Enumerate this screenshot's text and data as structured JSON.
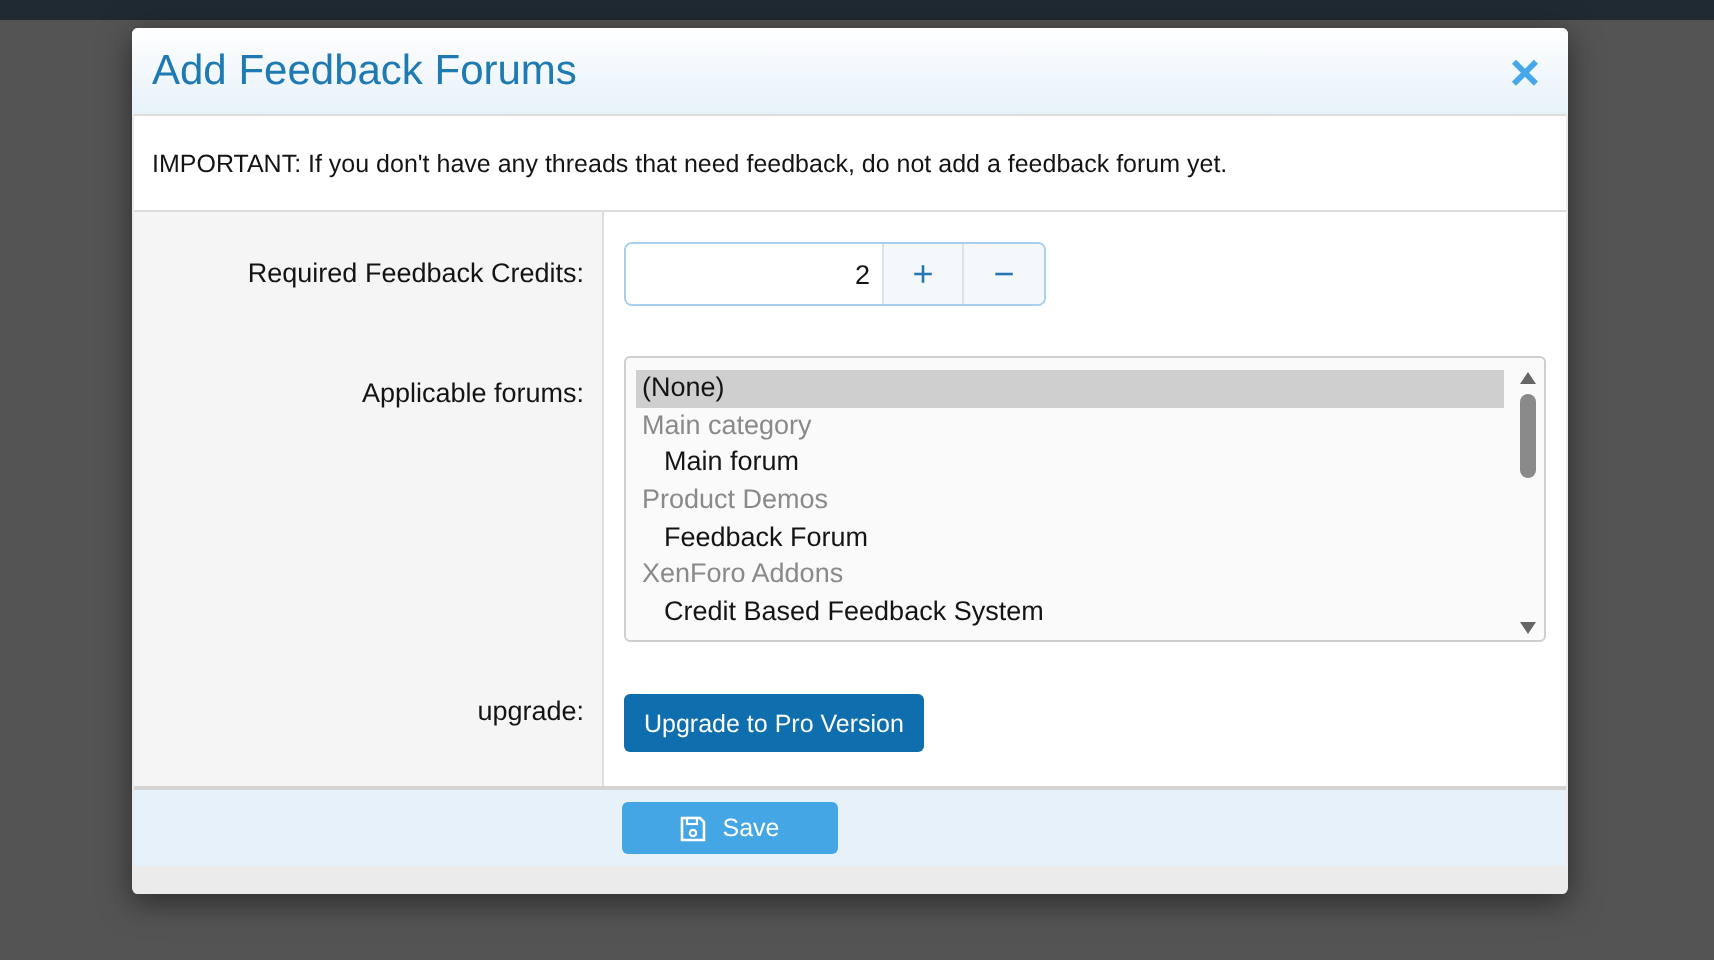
{
  "dialog": {
    "title": "Add Feedback Forums",
    "close": "×"
  },
  "notice": "IMPORTANT: If you don't have any threads that need feedback, do not add a feedback forum yet.",
  "form": {
    "credits": {
      "label": "Required Feedback Credits:",
      "value": "2",
      "plus": "+",
      "minus": "−"
    },
    "forums": {
      "label": "Applicable forums:",
      "options": [
        {
          "label": "(None)",
          "selected": true,
          "disabled": false
        },
        {
          "label": "Main category",
          "selected": false,
          "disabled": true,
          "children": [
            {
              "label": "Main forum",
              "selected": false,
              "disabled": false
            }
          ]
        },
        {
          "label": "Product Demos",
          "selected": false,
          "disabled": true,
          "children": [
            {
              "label": "Feedback Forum",
              "selected": false,
              "disabled": false
            }
          ]
        },
        {
          "label": "XenForo Addons",
          "selected": false,
          "disabled": true,
          "children": [
            {
              "label": "Credit Based Feedback System",
              "selected": false,
              "disabled": false
            }
          ]
        }
      ]
    },
    "upgrade": {
      "label": "upgrade:",
      "button": "Upgrade to Pro Version"
    }
  },
  "footer": {
    "save": "Save"
  }
}
